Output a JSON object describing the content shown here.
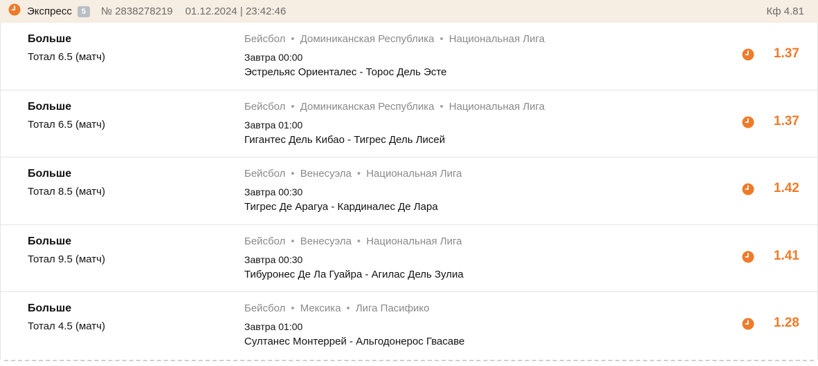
{
  "header": {
    "type_label": "Экспресс",
    "count": "5",
    "bet_number": "№ 2838278219",
    "datetime": "01.12.2024 | 23:42:46",
    "total_kf": "Кф 4.81"
  },
  "colors": {
    "accent": "#f07a28",
    "header_bg": "#f6ede3",
    "badge_bg": "#b9bec6",
    "muted_text": "#8a8a8a"
  },
  "icons": {
    "status": "clock-icon"
  },
  "selections": [
    {
      "outcome": "Больше",
      "market": "Тотал 6.5 (матч)",
      "sport": "Бейсбол",
      "country": "Доминиканская Республика",
      "league": "Национальная Лига",
      "start_time": "Завтра 00:00",
      "teams": "Эстрельяс Ориенталес - Торос Дель Эсте",
      "odds": "1.37"
    },
    {
      "outcome": "Больше",
      "market": "Тотал 6.5 (матч)",
      "sport": "Бейсбол",
      "country": "Доминиканская Республика",
      "league": "Национальная Лига",
      "start_time": "Завтра 01:00",
      "teams": "Гигантес Дель Кибао - Тигрес Дель Лисей",
      "odds": "1.37"
    },
    {
      "outcome": "Больше",
      "market": "Тотал 8.5 (матч)",
      "sport": "Бейсбол",
      "country": "Венесуэла",
      "league": "Национальная Лига",
      "start_time": "Завтра 00:30",
      "teams": "Тигрес Де Арагуа - Кардиналес Де Лара",
      "odds": "1.42"
    },
    {
      "outcome": "Больше",
      "market": "Тотал 9.5 (матч)",
      "sport": "Бейсбол",
      "country": "Венесуэла",
      "league": "Национальная Лига",
      "start_time": "Завтра 00:30",
      "teams": "Тибуронес Де Ла Гуайра - Агилас Дель Зулиа",
      "odds": "1.41"
    },
    {
      "outcome": "Больше",
      "market": "Тотал 4.5 (матч)",
      "sport": "Бейсбол",
      "country": "Мексика",
      "league": "Лига Пасифико",
      "start_time": "Завтра 01:00",
      "teams": "Султанес Монтеррей - Альгодонерос Гвасаве",
      "odds": "1.28"
    }
  ]
}
